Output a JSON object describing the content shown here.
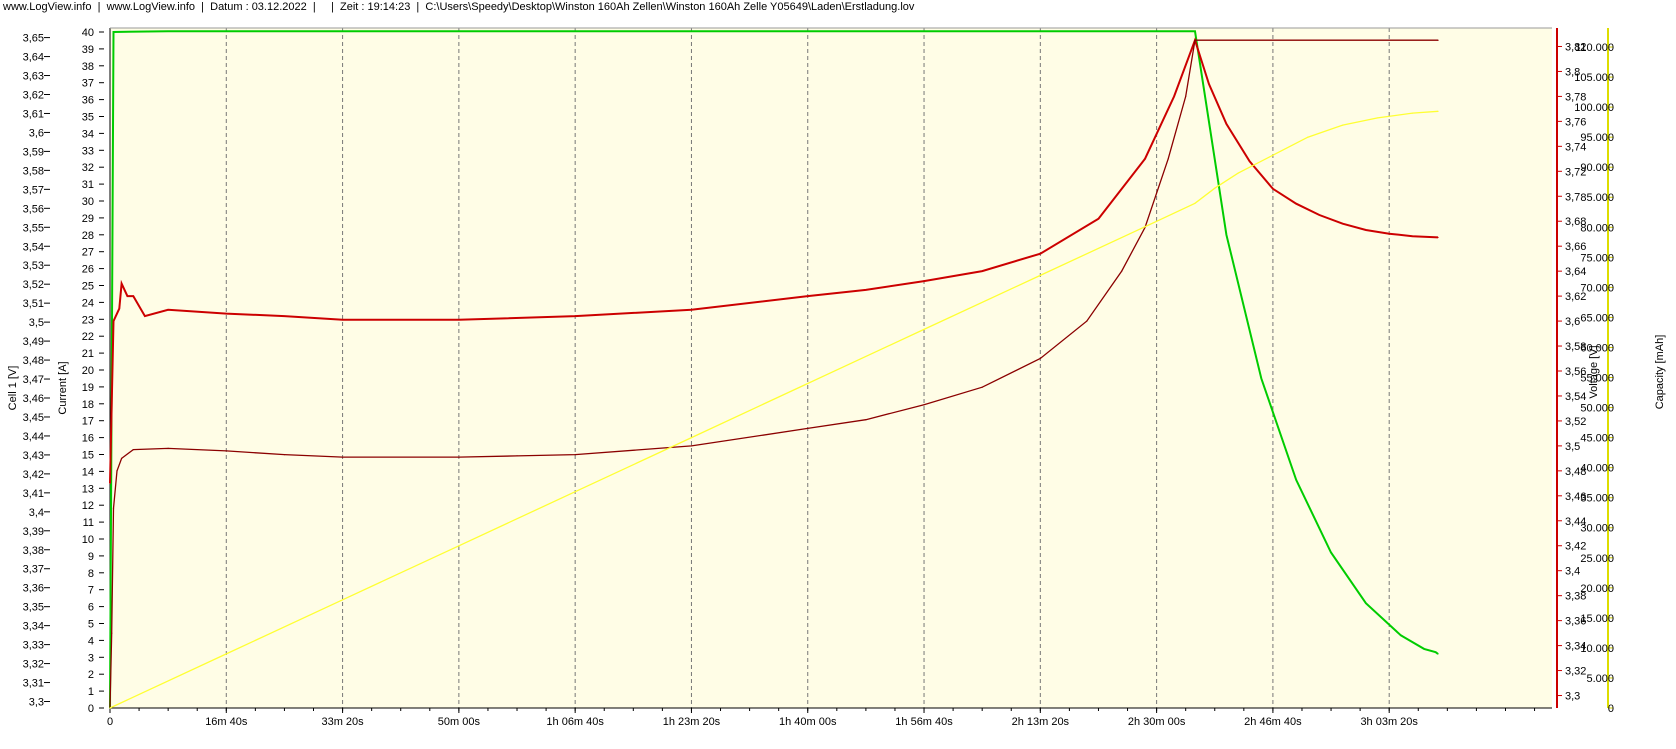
{
  "header": {
    "site1": "www.LogView.info",
    "site2": "www.LogView.info",
    "datum": "Datum : 03.12.2022",
    "zeit": "Zeit : 19:14:23",
    "path": "C:\\Users\\Speedy\\Desktop\\Winston 160Ah Zellen\\Winston 160Ah Zelle Y05649\\Laden\\Erstladung.lov"
  },
  "colors": {
    "plot_bg": "#fffde6",
    "cell": "#00cc00",
    "current": "#00cc00",
    "voltage_red": "#cc0000",
    "voltage_dark": "#8b0000",
    "capacity": "#ffff33"
  },
  "chart_data": {
    "type": "line",
    "title": "",
    "x_axis": {
      "unit": "seconds",
      "range": [
        0,
        12400
      ],
      "ticks": [
        {
          "value": 0,
          "label": "0"
        },
        {
          "value": 1000,
          "label": "16m 40s"
        },
        {
          "value": 2000,
          "label": "33m 20s"
        },
        {
          "value": 3000,
          "label": "50m 00s"
        },
        {
          "value": 4000,
          "label": "1h 06m 40s"
        },
        {
          "value": 5000,
          "label": "1h 23m 20s"
        },
        {
          "value": 6000,
          "label": "1h 40m 00s"
        },
        {
          "value": 7000,
          "label": "1h 56m 40s"
        },
        {
          "value": 8000,
          "label": "2h 13m 20s"
        },
        {
          "value": 9000,
          "label": "2h 30m 00s"
        },
        {
          "value": 10000,
          "label": "2h 46m 40s"
        },
        {
          "value": 11000,
          "label": "3h 03m 20s"
        }
      ]
    },
    "y_axes": {
      "cell": {
        "label": "Cell 1 [V]",
        "range": [
          3.295,
          3.654
        ],
        "ticks": [
          "3,3",
          "3,31",
          "3,32",
          "3,33",
          "3,34",
          "3,35",
          "3,36",
          "3,37",
          "3,38",
          "3,39",
          "3,4",
          "3,41",
          "3,42",
          "3,43",
          "3,44",
          "3,45",
          "3,46",
          "3,47",
          "3,48",
          "3,49",
          "3,5",
          "3,51",
          "3,52",
          "3,53",
          "3,54",
          "3,55",
          "3,56",
          "3,57",
          "3,58",
          "3,59",
          "3,6",
          "3,61",
          "3,62",
          "3,63",
          "3,64",
          "3,65"
        ]
      },
      "current": {
        "label": "Current [A]",
        "range": [
          0,
          40
        ],
        "ticks": [
          "0",
          "1",
          "2",
          "3",
          "4",
          "5",
          "6",
          "7",
          "8",
          "9",
          "10",
          "11",
          "12",
          "13",
          "14",
          "15",
          "16",
          "17",
          "18",
          "19",
          "20",
          "21",
          "22",
          "23",
          "24",
          "25",
          "26",
          "27",
          "28",
          "29",
          "30",
          "31",
          "32",
          "33",
          "34",
          "35",
          "36",
          "37",
          "38",
          "39",
          "40"
        ]
      },
      "voltage": {
        "label": "Voltage [V]",
        "range": [
          3.29,
          3.83
        ],
        "ticks": [
          "3,3",
          "3,32",
          "3,34",
          "3,36",
          "3,38",
          "3,4",
          "3,42",
          "3,44",
          "3,46",
          "3,48",
          "3,5",
          "3,52",
          "3,54",
          "3,56",
          "3,58",
          "3,6",
          "3,62",
          "3,64",
          "3,66",
          "3,68",
          "3,7",
          "3,72",
          "3,74",
          "3,76",
          "3,78",
          "3,8",
          "3,82"
        ]
      },
      "capacity": {
        "label": "Capacity [mAh]",
        "range": [
          0,
          112000
        ],
        "ticks": [
          "0",
          "5.000",
          "10.000",
          "15.000",
          "20.000",
          "25.000",
          "30.000",
          "35.000",
          "40.000",
          "45.000",
          "50.000",
          "55.000",
          "60.000",
          "65.000",
          "70.000",
          "75.000",
          "80.000",
          "85.000",
          "90.000",
          "95.000",
          "100.000",
          "105.000",
          "110.000"
        ]
      }
    },
    "series": [
      {
        "axis": "current",
        "color": "#00cc00",
        "points": [
          [
            0,
            0
          ],
          [
            30,
            40
          ],
          [
            500,
            40.05
          ],
          [
            2000,
            40.05
          ],
          [
            4000,
            40.05
          ],
          [
            6000,
            40.05
          ],
          [
            8000,
            40.05
          ],
          [
            9300,
            40.05
          ],
          [
            9330,
            40.05
          ],
          [
            9600,
            28
          ],
          [
            9900,
            19.5
          ],
          [
            10200,
            13.5
          ],
          [
            10500,
            9.2
          ],
          [
            10800,
            6.2
          ],
          [
            11100,
            4.3
          ],
          [
            11300,
            3.5
          ],
          [
            11400,
            3.3
          ],
          [
            11420,
            3.2
          ]
        ]
      },
      {
        "axis": "voltage",
        "color": "#cc0000",
        "points": [
          [
            0,
            3.47
          ],
          [
            30,
            3.6
          ],
          [
            80,
            3.61
          ],
          [
            100,
            3.63
          ],
          [
            150,
            3.62
          ],
          [
            200,
            3.62
          ],
          [
            300,
            3.604
          ],
          [
            500,
            3.609
          ],
          [
            1000,
            3.606
          ],
          [
            1500,
            3.604
          ],
          [
            2000,
            3.601
          ],
          [
            3000,
            3.601
          ],
          [
            4000,
            3.604
          ],
          [
            5000,
            3.609
          ],
          [
            6000,
            3.62
          ],
          [
            6500,
            3.625
          ],
          [
            7000,
            3.632
          ],
          [
            7500,
            3.64
          ],
          [
            8000,
            3.654
          ],
          [
            8500,
            3.682
          ],
          [
            8900,
            3.73
          ],
          [
            9150,
            3.78
          ],
          [
            9330,
            3.825
          ],
          [
            9450,
            3.79
          ],
          [
            9600,
            3.758
          ],
          [
            9800,
            3.728
          ],
          [
            10000,
            3.706
          ],
          [
            10200,
            3.694
          ],
          [
            10400,
            3.685
          ],
          [
            10600,
            3.678
          ],
          [
            10800,
            3.673
          ],
          [
            11000,
            3.67
          ],
          [
            11200,
            3.668
          ],
          [
            11420,
            3.667
          ]
        ]
      },
      {
        "axis": "voltage",
        "color": "#8b0000",
        "points": [
          [
            0,
            3.29
          ],
          [
            15,
            3.35
          ],
          [
            30,
            3.45
          ],
          [
            60,
            3.48
          ],
          [
            100,
            3.49
          ],
          [
            200,
            3.497
          ],
          [
            500,
            3.498
          ],
          [
            1000,
            3.496
          ],
          [
            1500,
            3.493
          ],
          [
            2000,
            3.491
          ],
          [
            3000,
            3.491
          ],
          [
            3500,
            3.492
          ],
          [
            4000,
            3.493
          ],
          [
            5000,
            3.5
          ],
          [
            6000,
            3.514
          ],
          [
            6500,
            3.521
          ],
          [
            7000,
            3.533
          ],
          [
            7500,
            3.547
          ],
          [
            8000,
            3.57
          ],
          [
            8400,
            3.6
          ],
          [
            8700,
            3.64
          ],
          [
            8900,
            3.675
          ],
          [
            9100,
            3.73
          ],
          [
            9250,
            3.78
          ],
          [
            9330,
            3.825
          ],
          [
            11420,
            3.825
          ]
        ]
      },
      {
        "axis": "capacity",
        "color": "#ffff33",
        "points": [
          [
            0,
            0
          ],
          [
            1000,
            9000
          ],
          [
            2000,
            18000
          ],
          [
            3000,
            27000
          ],
          [
            4000,
            36000
          ],
          [
            5000,
            45000
          ],
          [
            6000,
            54000
          ],
          [
            7000,
            63000
          ],
          [
            8000,
            72000
          ],
          [
            9000,
            81000
          ],
          [
            9330,
            84000
          ],
          [
            9500,
            86500
          ],
          [
            9700,
            89000
          ],
          [
            10000,
            92000
          ],
          [
            10300,
            95000
          ],
          [
            10600,
            97000
          ],
          [
            10900,
            98200
          ],
          [
            11200,
            99000
          ],
          [
            11420,
            99300
          ]
        ]
      }
    ]
  }
}
